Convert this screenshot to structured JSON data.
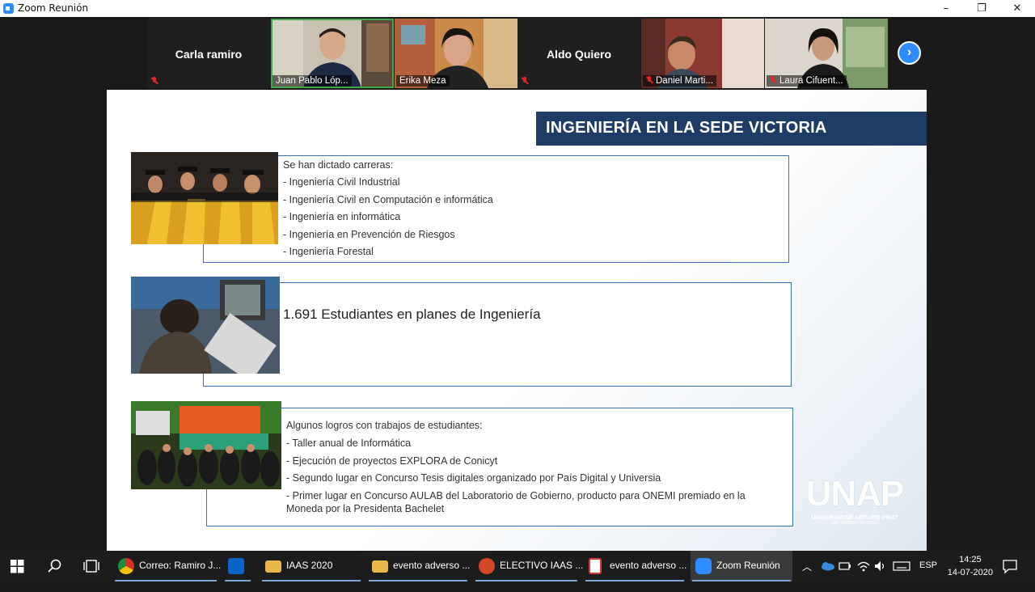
{
  "window": {
    "title": "Zoom Reunión",
    "minimize": "–",
    "maximize": "❐",
    "close": "✕"
  },
  "participants": [
    {
      "name": "Carla ramiro",
      "video": false,
      "muted": true
    },
    {
      "name": "Juan Pablo Lóp...",
      "video": true,
      "muted": false
    },
    {
      "name": "Erika Meza",
      "video": true,
      "muted": false
    },
    {
      "name": "Aldo Quiero",
      "video": false,
      "muted": true
    },
    {
      "name": "Daniel Marti...",
      "video": true,
      "muted": true
    },
    {
      "name": "Laura Cifuent...",
      "video": true,
      "muted": true
    }
  ],
  "slide": {
    "title": "INGENIERÍA EN LA SEDE VICTORIA",
    "section1": {
      "heading": "Se han dictado carreras:",
      "items": [
        "- Ingeniería Civil Industrial",
        "- Ingeniería Civil en Computación e informática",
        "- Ingeniería en informática",
        "- Ingeniería en Prevención de Riesgos",
        "- Ingeniería Forestal"
      ]
    },
    "section2": {
      "text": "1.691 Estudiantes en planes de Ingeniería"
    },
    "section3": {
      "heading": "Algunos logros con trabajos de estudiantes:",
      "items": [
        "- Taller anual de Informática",
        "- Ejecución de proyectos EXPLORA de Conicyt",
        "- Segundo lugar en Concurso Tesis digitales organizado por País Digital y Universia",
        "- Primer lugar en Concurso AULAB del Laboratorio de Gobierno, producto para ONEMI premiado  en la",
        "Moneda por la Presidenta Bachelet"
      ]
    },
    "logo": {
      "name": "UNAP",
      "subtitle": "UNIVERSIDAD ARTURO PRAT",
      "tagline": "DEL ESTADO DE CHILE"
    }
  },
  "taskbar": {
    "apps": [
      {
        "label": "Correo: Ramiro J...",
        "icon": "chrome-icon",
        "color": "#e0b020"
      },
      {
        "label": "",
        "icon": "outlook-icon",
        "color": "#0a64c8"
      },
      {
        "label": "IAAS 2020",
        "icon": "folder-icon",
        "color": "#e8b64a"
      },
      {
        "label": "evento adverso ...",
        "icon": "folder-icon",
        "color": "#e8b64a"
      },
      {
        "label": "ELECTIVO IAAS ...",
        "icon": "powerpoint-icon",
        "color": "#d24726"
      },
      {
        "label": "evento adverso ...",
        "icon": "pdf-icon",
        "color": "#e03a3a"
      },
      {
        "label": "Zoom Reunión",
        "icon": "zoom-icon",
        "color": "#2d8cff"
      }
    ],
    "language": "ESP",
    "time": "14:25",
    "date": "14-07-2020"
  }
}
